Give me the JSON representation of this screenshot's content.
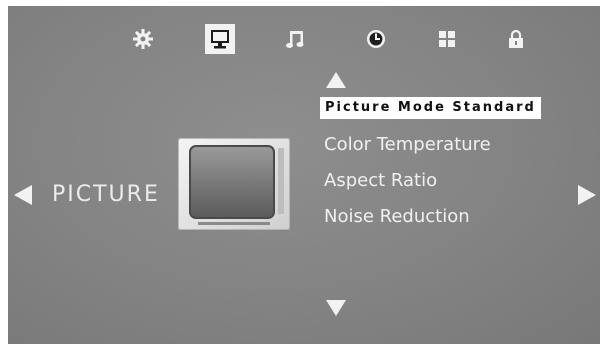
{
  "menu": {
    "tabs": [
      {
        "icon": "gear-icon",
        "active": false
      },
      {
        "icon": "monitor-icon",
        "active": true
      },
      {
        "icon": "music-note-icon",
        "active": false
      },
      {
        "icon": "clock-icon",
        "active": false
      },
      {
        "icon": "grid-icon",
        "active": false
      },
      {
        "icon": "lock-icon",
        "active": false
      }
    ]
  },
  "section": {
    "title": "PICTURE",
    "icon": "tv-thumbnail-icon"
  },
  "items": [
    {
      "label": "Picture Mode Standard",
      "selected": true
    },
    {
      "label": "Color Temperature",
      "selected": false
    },
    {
      "label": "Aspect Ratio",
      "selected": false
    },
    {
      "label": "Noise Reduction",
      "selected": false
    }
  ],
  "colors": {
    "background": "#838383",
    "text": "#f0f0f0",
    "highlight": "#ffffff"
  }
}
